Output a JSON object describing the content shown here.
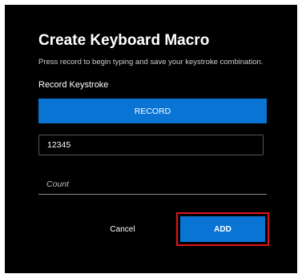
{
  "dialog": {
    "title": "Create Keyboard Macro",
    "subtitle": "Press record to begin typing and save your keystroke combination.",
    "section_label": "Record Keystroke",
    "record_label": "RECORD",
    "keystroke_value": "12345",
    "count_placeholder": "Count",
    "cancel_label": "Cancel",
    "add_label": "ADD"
  },
  "colors": {
    "dialog_background": "#000000",
    "accent": "#0a74d4",
    "highlight_border": "#e0141b"
  }
}
